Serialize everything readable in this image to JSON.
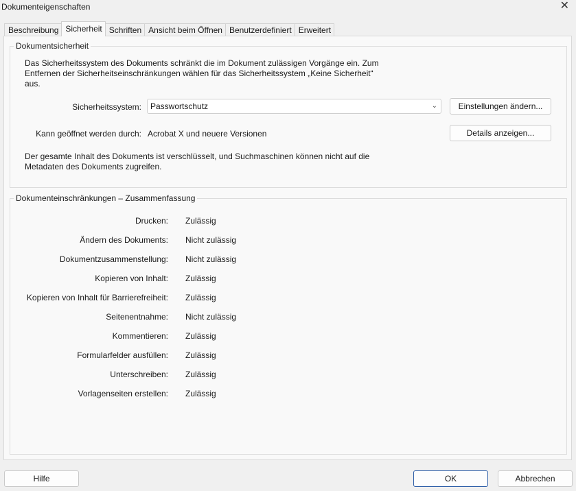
{
  "window": {
    "title": "Dokumenteigenschaften",
    "close_glyph": "✕"
  },
  "tabs": [
    {
      "label": "Beschreibung",
      "active": false
    },
    {
      "label": "Sicherheit",
      "active": true
    },
    {
      "label": "Schriften",
      "active": false
    },
    {
      "label": "Ansicht beim Öffnen",
      "active": false
    },
    {
      "label": "Benutzerdefiniert",
      "active": false
    },
    {
      "label": "Erweitert",
      "active": false
    }
  ],
  "security": {
    "group_title": "Dokumentsicherheit",
    "description_lines": [
      "Das Sicherheitssystem des Dokuments schränkt die im Dokument zulässigen Vorgänge ein. Zum",
      "Entfernen der Sicherheitseinschränkungen wählen für das Sicherheitssystem „Keine Sicherheit“",
      "aus."
    ],
    "system_label": "Sicherheitssystem:",
    "system_value": "Passwortschutz",
    "change_settings_button": "Einstellungen ändern...",
    "open_label": "Kann geöffnet werden durch:",
    "open_value": "Acrobat X und neuere Versionen",
    "details_button": "Details anzeigen...",
    "encryption_lines": [
      "Der gesamte Inhalt des Dokuments ist verschlüsselt, und Suchmaschinen können nicht auf die",
      "Metadaten des Dokuments zugreifen."
    ]
  },
  "restrictions": {
    "group_title": "Dokumenteinschränkungen – Zusammenfassung",
    "rows": [
      {
        "label": "Drucken:",
        "value": "Zulässig"
      },
      {
        "label": "Ändern des Dokuments:",
        "value": "Nicht zulässig"
      },
      {
        "label": "Dokumentzusammenstellung:",
        "value": "Nicht zulässig"
      },
      {
        "label": "Kopieren von Inhalt:",
        "value": "Zulässig"
      },
      {
        "label": "Kopieren von Inhalt für Barrierefreiheit:",
        "value": "Zulässig"
      },
      {
        "label": "Seitenentnahme:",
        "value": "Nicht zulässig"
      },
      {
        "label": "Kommentieren:",
        "value": "Zulässig"
      },
      {
        "label": "Formularfelder ausfüllen:",
        "value": "Zulässig"
      },
      {
        "label": "Unterschreiben:",
        "value": "Zulässig"
      },
      {
        "label": "Vorlagenseiten erstellen:",
        "value": "Zulässig"
      }
    ]
  },
  "footer": {
    "help_button": "Hilfe",
    "ok_button": "OK",
    "cancel_button": "Abbrechen"
  }
}
